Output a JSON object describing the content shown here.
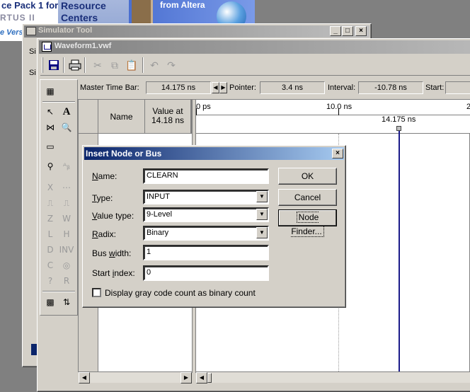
{
  "banner": {
    "promo_line1": "ce Pack 1 for",
    "promo_line2": "RTUS II",
    "promo_line3": "e Vers",
    "resource_title": "Resource Centers",
    "altera_text": "from Altera"
  },
  "simulator_tool": {
    "title": "Simulator Tool",
    "left_label_1": "Si",
    "left_label_2": "Si"
  },
  "waveform": {
    "title": "Waveform1.vwf",
    "master_time_bar_label": "Master Time Bar:",
    "master_time_bar_value": "14.175 ns",
    "pointer_label": "Pointer:",
    "pointer_value": "3.4 ns",
    "interval_label": "Interval:",
    "interval_value": "-10.78 ns",
    "start_label": "Start:",
    "col_name": "Name",
    "col_value_line1": "Value at",
    "col_value_line2": "14.18 ns",
    "timeline_0": "0 ps",
    "timeline_10": "10.0 ns",
    "timeline_20": "2",
    "marker_label": "14.175 ns"
  },
  "dialog": {
    "title": "Insert Node or Bus",
    "name_label": "Name:",
    "name_value": "CLEARN",
    "type_label": "Type:",
    "type_value": "INPUT",
    "value_type_label": "Value type:",
    "value_type_value": "9-Level",
    "radix_label": "Radix:",
    "radix_value": "Binary",
    "bus_width_label": "Bus width:",
    "bus_width_value": "1",
    "start_index_label": "Start index:",
    "start_index_value": "0",
    "gray_code_label": "Display gray code count as binary count",
    "gray_code_checked": false,
    "ok_label": "OK",
    "cancel_label": "Cancel",
    "node_finder_label": "Node Finder..."
  },
  "colors": {
    "active_title": "#0a246a",
    "inactive_title": "#808080",
    "marker_line": "#1a1a8a",
    "desktop": "#808080"
  }
}
